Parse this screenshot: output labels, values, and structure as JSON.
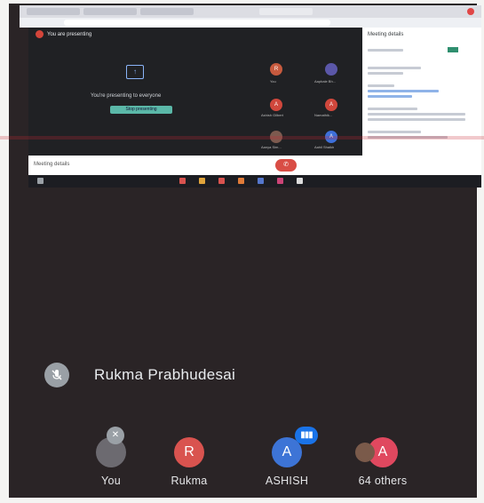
{
  "screen": {
    "presenting_label": "You are presenting",
    "presenting_to_everyone": "You're presenting to everyone",
    "stop_presenting_label": "Stop presenting",
    "mini_tiles": [
      {
        "initial": "R",
        "label": "You",
        "color": "#c75a3e"
      },
      {
        "initial": "",
        "label": "Aapbale Bh...",
        "color": "#5b57a8"
      },
      {
        "initial": "",
        "label": "Aanvi Ram",
        "color": "#d9643b"
      },
      {
        "initial": "A",
        "label": "Ashish Gilbert",
        "color": "#d0473c"
      },
      {
        "initial": "A",
        "label": "Namathik...",
        "color": "#d0473c"
      },
      {
        "initial": "",
        "label": "Aanya Sim...",
        "color": "#7d5a4f"
      },
      {
        "initial": "A",
        "label": "Aahil Shaikh",
        "color": "#3e6fd8"
      }
    ],
    "side_panel_title": "Meeting details",
    "control_meeting_details": "Meeting details",
    "end_call_icon": "phone-hangup-icon"
  },
  "speaker": {
    "name": "Rukma Prabhudesai",
    "mic_icon": "mic-off-icon"
  },
  "participants": [
    {
      "label": "You",
      "initial": "",
      "color": "#6c6a70",
      "badge": "mic-off"
    },
    {
      "label": "Rukma",
      "initial": "R",
      "color": "#d9534f",
      "badge": ""
    },
    {
      "label": "ASHISH",
      "initial": "A",
      "color": "#3d74d6",
      "badge": "speaking"
    },
    {
      "label": "64 others",
      "initial": "A",
      "color": "#e0485f",
      "badge": "stack"
    }
  ],
  "colors": {
    "stage_bg": "#202124",
    "accent_blue": "#1a73e8",
    "end_call_red": "#d94d45"
  }
}
